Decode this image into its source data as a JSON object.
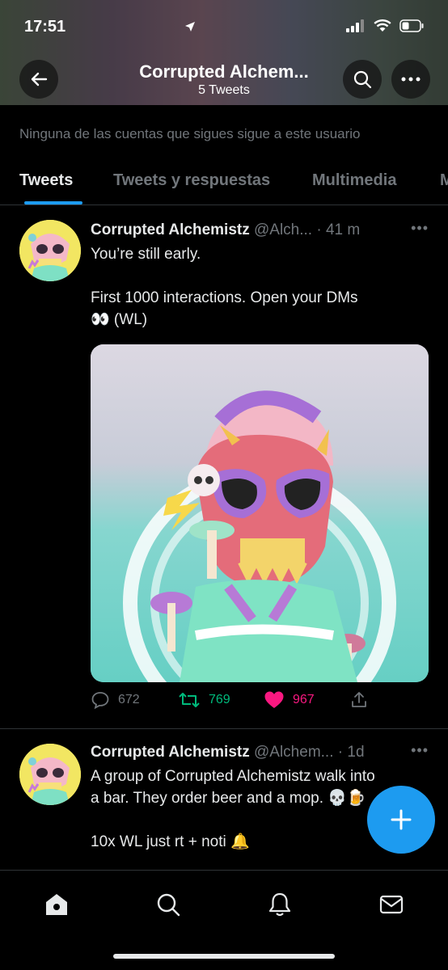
{
  "status_bar": {
    "time": "17:51"
  },
  "header": {
    "title": "Corrupted Alchem...",
    "tweet_count": "5 Tweets"
  },
  "follow_note": "Ninguna de las cuentas que sigues sigue a este usuario",
  "tabs": [
    {
      "label": "Tweets"
    },
    {
      "label": "Tweets y respuestas"
    },
    {
      "label": "Multimedia"
    },
    {
      "label": "M"
    }
  ],
  "tweets": [
    {
      "author": "Corrupted Alchemistz",
      "handle": "@Alch...",
      "time": "· 41 m",
      "text_line1": "You’re still early.",
      "text_line2": "First 1000 interactions. Open your DMs",
      "text_line3": "👀 (WL)",
      "replies": "672",
      "retweets": "769",
      "likes": "967"
    },
    {
      "author": "Corrupted Alchemistz",
      "handle": "@Alchem...",
      "time": "· 1d",
      "text_line1": "A group of Corrupted Alchemistz walk into",
      "text_line2": "a bar. They order beer and a mop. 💀🍺",
      "text_line3": "10x WL just rt + noti 🔔"
    }
  ],
  "colors": {
    "accent": "#1d9bf0",
    "retweet": "#00ba7c",
    "like": "#f91880",
    "muted": "#71767b"
  }
}
